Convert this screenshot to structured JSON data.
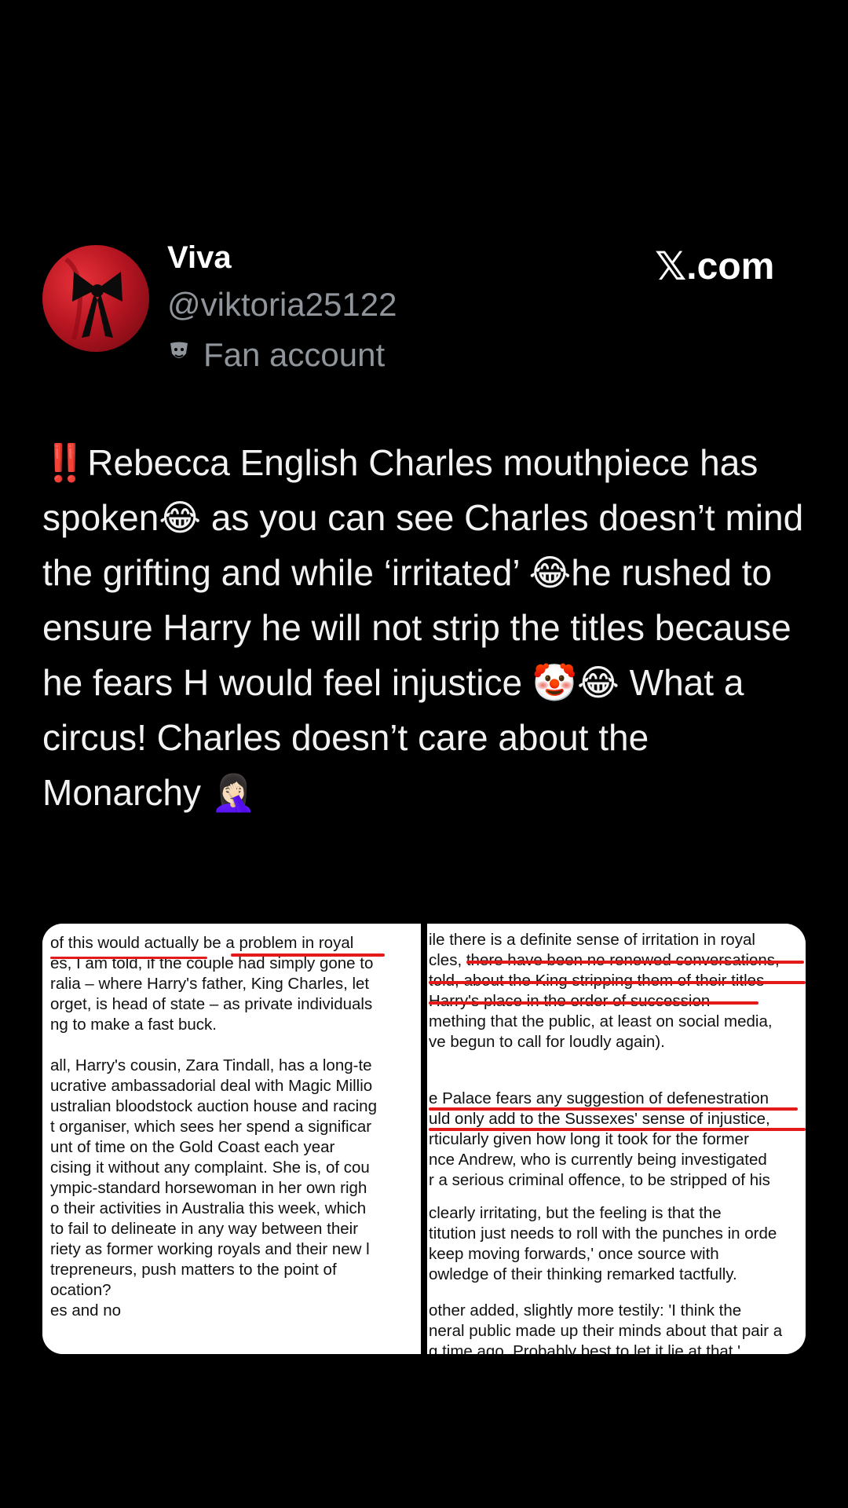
{
  "header": {
    "name": "Viva",
    "handle": "@viktoria25122",
    "badge_icon": "theater-masks-icon",
    "badge_label": "Fan account",
    "brand": ".com",
    "brand_logo": "x-logo-icon"
  },
  "tweet": {
    "emoji_double_excl": "‼️",
    "text_1": "Rebecca English Charles mouthpiece has spoken",
    "emoji_laugh_1": "😂",
    "text_2": " as you can see Charles doesn’t mind the grifting and while ‘irritated’ ",
    "emoji_laugh_2": "😂",
    "text_3": "he rushed to ensure Harry he will not strip the titles because he fears H would feel injustice ",
    "emoji_clown": "🤡",
    "emoji_laugh_3": "😂",
    "text_4": " What a circus! Charles doesn’t care about the Monarchy ",
    "emoji_facepalm": "🤦🏻‍♀️"
  },
  "media": {
    "left_lines": [
      "of this would actually be a problem in royal",
      "es, I am told, if the couple had simply gone to",
      "ralia – where Harry's father, King Charles, let",
      "orget, is head of state – as private individuals",
      "ng to make a fast buck.",
      "all, Harry's cousin, Zara Tindall, has a long-te",
      "ucrative ambassadorial deal with Magic Millio",
      "ustralian bloodstock auction house and racing",
      "t organiser, which sees her spend a significar",
      "unt of time on the Gold Coast each year",
      "cising it without any complaint. She is, of cou",
      "ympic-standard horsewoman in her own righ",
      "o their activities in Australia this week, which",
      "to fail to delineate in any way between their",
      "riety as former working royals and their new l",
      "trepreneurs, push matters to the point of",
      "ocation?",
      "es and no"
    ],
    "right_lines": [
      "ile there is a definite sense of irritation in royal",
      "cles, there have been no renewed conversations,",
      "told, about the King stripping them of their titles",
      "Harry's place in the order of succession",
      "mething that the public, at least on social media,",
      "ve begun to call for loudly again).",
      "e Palace fears any suggestion of defenestration",
      "uld only add to the Sussexes' sense of injustice,",
      "rticularly given how long it took for the former",
      "nce Andrew, who is currently being investigated",
      "r a serious criminal offence, to be stripped of his",
      "clearly irritating, but the feeling is that the",
      "titution just needs to roll with the punches in orde",
      "keep moving forwards,' once source with",
      "owledge of their thinking remarked tactfully.",
      "other added, slightly more testily: 'I think the",
      "neral public made up their minds about that pair a",
      "g time ago. Probably best to let it lie at that.'"
    ]
  }
}
